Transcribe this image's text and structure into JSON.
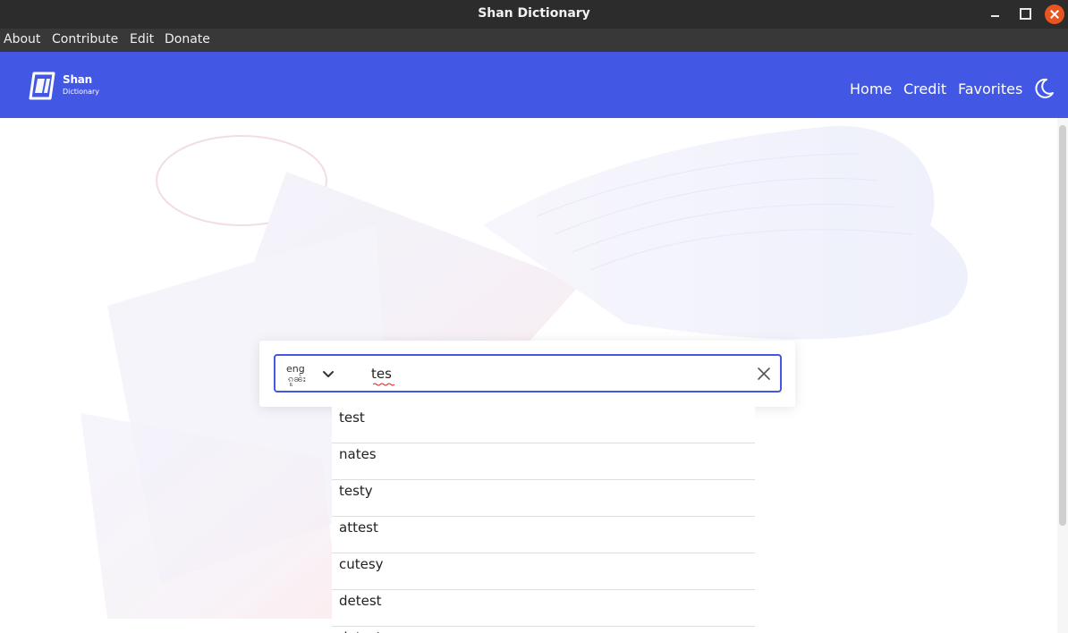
{
  "window": {
    "title": "Shan Dictionary"
  },
  "menu": [
    "About",
    "Contribute",
    "Edit",
    "Donate"
  ],
  "header": {
    "logo_title": "Shan",
    "logo_subtitle": "Dictionary",
    "nav": [
      "Home",
      "Credit",
      "Favorites"
    ],
    "theme_icon": "moon-icon"
  },
  "search": {
    "language_top": "eng",
    "language_bottom": "ၵူၼ်း",
    "value": "tes",
    "placeholder": ""
  },
  "suggestions": [
    "test",
    "nates",
    "testy",
    "attest",
    "cutesy",
    "detest",
    "detests"
  ],
  "colors": {
    "accent": "#4257e4",
    "titlebar": "#2c2c2c",
    "menubar": "#383838",
    "close": "#e95420"
  }
}
